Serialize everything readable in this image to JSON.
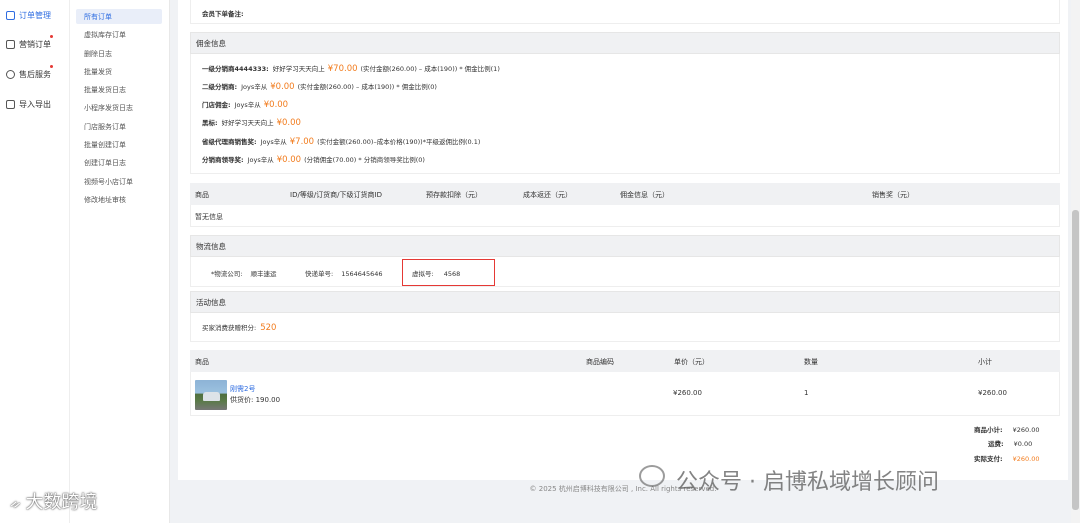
{
  "nav_primary": [
    {
      "label": "订单管理",
      "icon": "document-icon",
      "active": true,
      "badge": false
    },
    {
      "label": "营销订单",
      "icon": "cart-icon",
      "active": false,
      "badge": true
    },
    {
      "label": "售后服务",
      "icon": "service-icon",
      "active": false,
      "badge": true
    },
    {
      "label": "导入导出",
      "icon": "import-icon",
      "active": false,
      "badge": false
    }
  ],
  "nav_secondary": [
    {
      "label": "所有订单",
      "active": true
    },
    {
      "label": "虚拟库存订单",
      "active": false
    },
    {
      "label": "删除日志",
      "active": false
    },
    {
      "label": "批量发货",
      "active": false
    },
    {
      "label": "批量发货日志",
      "active": false
    },
    {
      "label": "小程序发货日志",
      "active": false
    },
    {
      "label": "门店服务订单",
      "active": false
    },
    {
      "label": "批量创建订单",
      "active": false
    },
    {
      "label": "创建订单日志",
      "active": false
    },
    {
      "label": "视频号小店订单",
      "active": false
    },
    {
      "label": "修改地址审核",
      "active": false
    }
  ],
  "member_remark_label": "会员下单备注:",
  "commission": {
    "title": "佣金信息",
    "rows": [
      {
        "label": "一级分销商4444333:",
        "name": "好好学习天天向上",
        "amount": "¥70.00",
        "formula": "(实付金额(260.00) – 成本(190)) * 佣金比例(1)"
      },
      {
        "label": "二级分销商:",
        "name": "Joys辛从",
        "amount": "¥0.00",
        "formula": "(实付金额(260.00) – 成本(190)) * 佣金比例(0)"
      },
      {
        "label": "门店佣金:",
        "name": "Joys辛从",
        "amount": "¥0.00",
        "formula": ""
      },
      {
        "label": "黑标:",
        "name": "好好学习天天向上",
        "amount": "¥0.00",
        "formula": ""
      },
      {
        "label": "省级代理商销售奖:",
        "name": "Joys辛从",
        "amount": "¥7.00",
        "formula": "(实付金额(260.00)–成本价格(190))*平级返佣比例(0.1)"
      },
      {
        "label": "分销商领导奖:",
        "name": "Joys辛从",
        "amount": "¥0.00",
        "formula": "(分销佣金(70.00) * 分销商领导奖比例(0)"
      }
    ]
  },
  "supplier_table": {
    "headers": [
      "商品",
      "ID/等级/订货商/下级订货商ID",
      "预存款扣除（元）",
      "成本返还（元）",
      "佣金信息（元）",
      "销售奖（元）"
    ],
    "empty_text": "暂无信息"
  },
  "logistics": {
    "title": "物流信息",
    "company_label": "*物流公司:",
    "company_value": "顺丰速运",
    "tracking_label": "快递单号:",
    "tracking_value": "1564645646",
    "virtual_label": "虚拟号:",
    "virtual_value": "4568"
  },
  "activity": {
    "title": "活动信息",
    "points_label": "买家消费获赠积分:",
    "points_value": "520"
  },
  "goods_table": {
    "headers": [
      "商品",
      "商品编码",
      "单价（元）",
      "数量",
      "小计"
    ],
    "rows": [
      {
        "name": "刚需2号",
        "supply_price": "供货价:  190.00",
        "code": "",
        "price": "¥260.00",
        "qty": "1",
        "subtotal": "¥260.00"
      }
    ]
  },
  "totals": {
    "subtotal_label": "商品小计:",
    "subtotal_value": "¥260.00",
    "shipping_label": "运费:",
    "shipping_value": "¥0.00",
    "paid_label": "实际支付:",
    "paid_value": "¥260.00"
  },
  "footer": "© 2025 杭州启博科技有限公司 , Inc. All rights reserved.",
  "watermark_right": "公众号 · 启博私域增长顾问",
  "watermark_left": "大数跨境",
  "colors": {
    "accent": "#2f6de1",
    "orange": "#f27c1e",
    "highlight": "#e53935"
  }
}
